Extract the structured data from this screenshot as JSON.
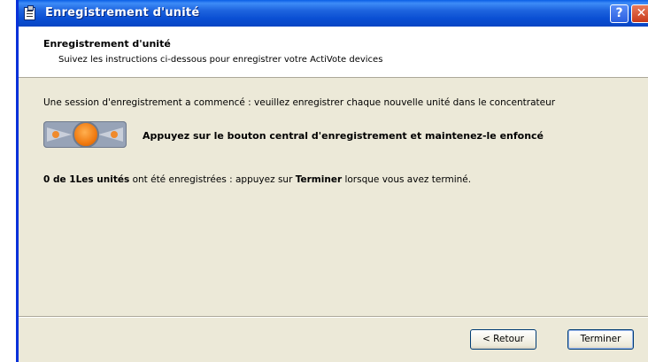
{
  "window": {
    "title": "Enregistrement d'unité",
    "help_glyph": "?",
    "close_glyph": "✕"
  },
  "header": {
    "title": "Enregistrement d'unité",
    "subtitle": "Suivez les instructions ci-dessous pour enregistrer votre ActiVote devices"
  },
  "content": {
    "instruction": "Une session d'enregistrement a commencé : veuillez enregistrer chaque nouvelle unité dans le concentrateur",
    "device_prompt": "Appuyez sur le bouton central d'enregistrement et maintenez-le enfoncé",
    "status_count": "0 de 1",
    "status_units": "Les unités",
    "status_mid": " ont été enregistrées : appuyez sur ",
    "status_finish_word": "Terminer",
    "status_end": " lorsque vous avez terminé."
  },
  "buttons": {
    "back_label": "< Retour",
    "finish_label": "Terminer"
  }
}
